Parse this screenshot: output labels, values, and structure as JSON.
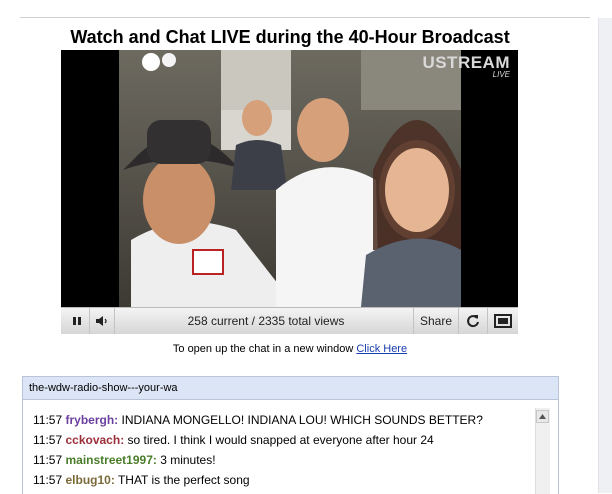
{
  "page": {
    "title": "Watch and Chat LIVE during the 40-Hour Broadcast"
  },
  "player": {
    "logo_brand": "USTREAM",
    "logo_sub": "LIVE",
    "view_count": "258 current / 2335 total views",
    "share_label": "Share",
    "icons": [
      "pause-icon",
      "volume-icon",
      "refresh-icon",
      "fullscreen-icon"
    ]
  },
  "open_chat": {
    "prefix": "To open up the chat in a new window ",
    "link_label": "Click Here"
  },
  "chat": {
    "channel": "the-wdw-radio-show---your-wa",
    "messages": [
      {
        "time": "11:57",
        "user": "frybergh:",
        "text": " INDIANA MONGELLO! INDIANA LOU! WHICH SOUNDS BETTER?",
        "color": "#6b3fa0"
      },
      {
        "time": "11:57",
        "user": "cckovach:",
        "text": " so tired.  I think I would snapped at everyone after hour 24",
        "color": "#9a2f3a"
      },
      {
        "time": "11:57",
        "user": "mainstreet1997:",
        "text": " 3 minutes!",
        "color": "#4a7d2a"
      },
      {
        "time": "11:57",
        "user": "elbug10:",
        "text": " THAT is the perfect song",
        "color": "#7a6a3a"
      }
    ]
  }
}
